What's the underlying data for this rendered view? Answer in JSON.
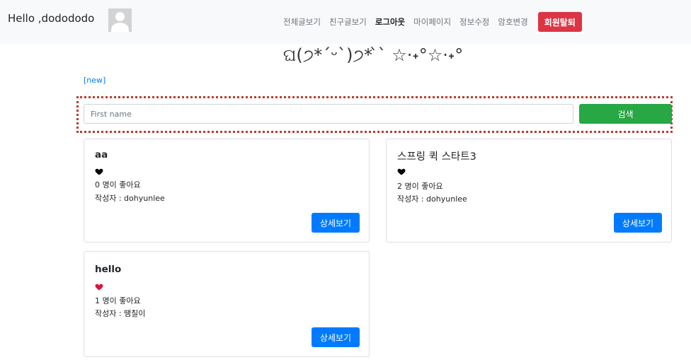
{
  "header": {
    "greeting": "Hello ,dodododo",
    "nav": [
      "전체글보기",
      "친구글보기",
      "로그아웃",
      "마이페이지",
      "정보수정",
      "암호변경"
    ],
    "active_nav": "로그아웃",
    "withdraw_label": "회원탈퇴"
  },
  "banner": {
    "kaomoji": "ଘ(੭*ˊᵕˋ)੭* ̀ˋ ☆·˖°☆·˖°"
  },
  "new_link": "[new]",
  "search": {
    "placeholder": "First name",
    "value": "",
    "button_label": "검색"
  },
  "posts": [
    {
      "title": "aa",
      "likes": "0 명이 좋아요",
      "author": "작성자 : dohyunlee",
      "liked": false,
      "button_label": "상세보기"
    },
    {
      "title": "스프링 퀵 스타트3",
      "likes": "2 명이 좋아요",
      "author": "작성자 : dohyunlee",
      "liked": false,
      "button_label": "상세보기"
    },
    {
      "title": "hello",
      "likes": "1 명이 좋아요",
      "author": "작성자 : 땡칠이",
      "liked": true,
      "button_label": "상세보기"
    }
  ],
  "colors": {
    "heart_liked": "#dc143c",
    "heart_unliked": "#000000",
    "danger": "#dc3545",
    "success": "#28a745",
    "primary": "#007bff",
    "highlight_frame": "#c0392b"
  }
}
